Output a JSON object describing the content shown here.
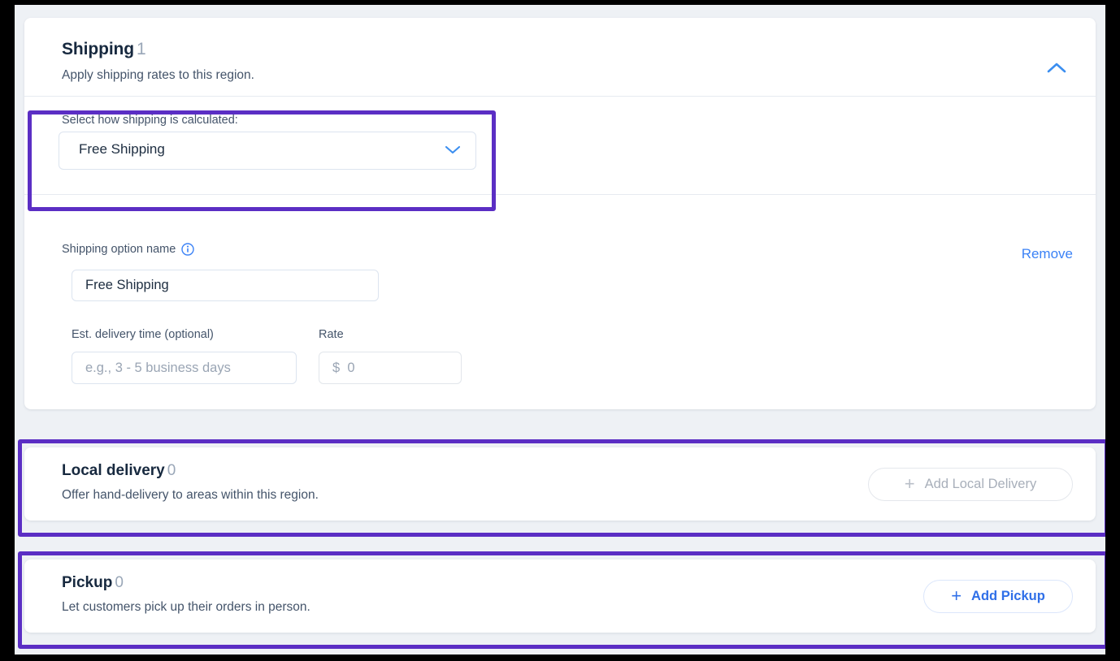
{
  "shipping_section": {
    "title": "Shipping",
    "count": "1",
    "subtitle": "Apply shipping rates to this region.",
    "collapse_icon": "chevron-up-icon",
    "calculation": {
      "label": "Select how shipping is calculated:",
      "selected": "Free Shipping",
      "caret_icon": "chevron-down-icon"
    },
    "option": {
      "name_label": "Shipping option name",
      "info_icon": "info-circle-icon",
      "name_value": "Free Shipping",
      "remove_label": "Remove",
      "eta_label": "Est. delivery time (optional)",
      "eta_placeholder": "e.g., 3 - 5 business days",
      "eta_value": "",
      "rate_label": "Rate",
      "rate_placeholder": "$  0",
      "rate_value": ""
    }
  },
  "local_delivery_section": {
    "title": "Local delivery",
    "count": "0",
    "subtitle": "Offer hand-delivery to areas within this region.",
    "button_label": "Add Local Delivery",
    "button_icon": "plus-icon",
    "button_state": "disabled"
  },
  "pickup_section": {
    "title": "Pickup",
    "count": "0",
    "subtitle": "Let customers pick up their orders in person.",
    "button_label": "Add Pickup",
    "button_icon": "plus-icon",
    "button_state": "enabled"
  },
  "colors": {
    "highlight": "#5b2ec4",
    "accent_blue": "#2f6fe8",
    "link_blue": "#3b82f6",
    "heading": "#17293f",
    "body_text": "#44546a",
    "muted": "#9aa7b8",
    "page_background": "#eef1f5",
    "card_background": "#ffffff"
  }
}
